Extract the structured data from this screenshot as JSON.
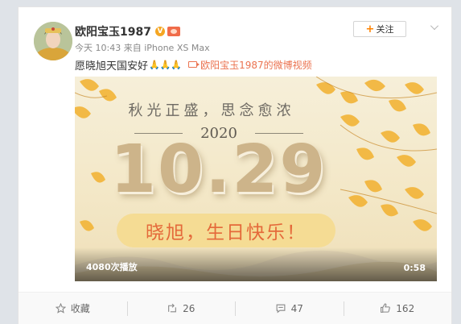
{
  "post": {
    "author": "欧阳宝玉1987",
    "verified_badge": "V",
    "meta": "今天 10:43 来自 iPhone XS Max",
    "text": "愿晓旭天国安好",
    "emoji": "🙏🙏🙏",
    "video_link": "欧阳宝玉1987的微博视频",
    "follow_label": "关注",
    "follow_plus": "+"
  },
  "video": {
    "headline": "秋光正盛，思念愈浓",
    "year": "2020",
    "date": "10.29",
    "message": "晓旭，生日快乐！",
    "plays": "4080次播放",
    "duration": "0:58"
  },
  "actions": {
    "favorite": "收藏",
    "repost": "26",
    "comment": "47",
    "like": "162"
  },
  "colors": {
    "accent": "#ff8200",
    "link": "#eb7350",
    "pill_text": "#e4693a"
  }
}
